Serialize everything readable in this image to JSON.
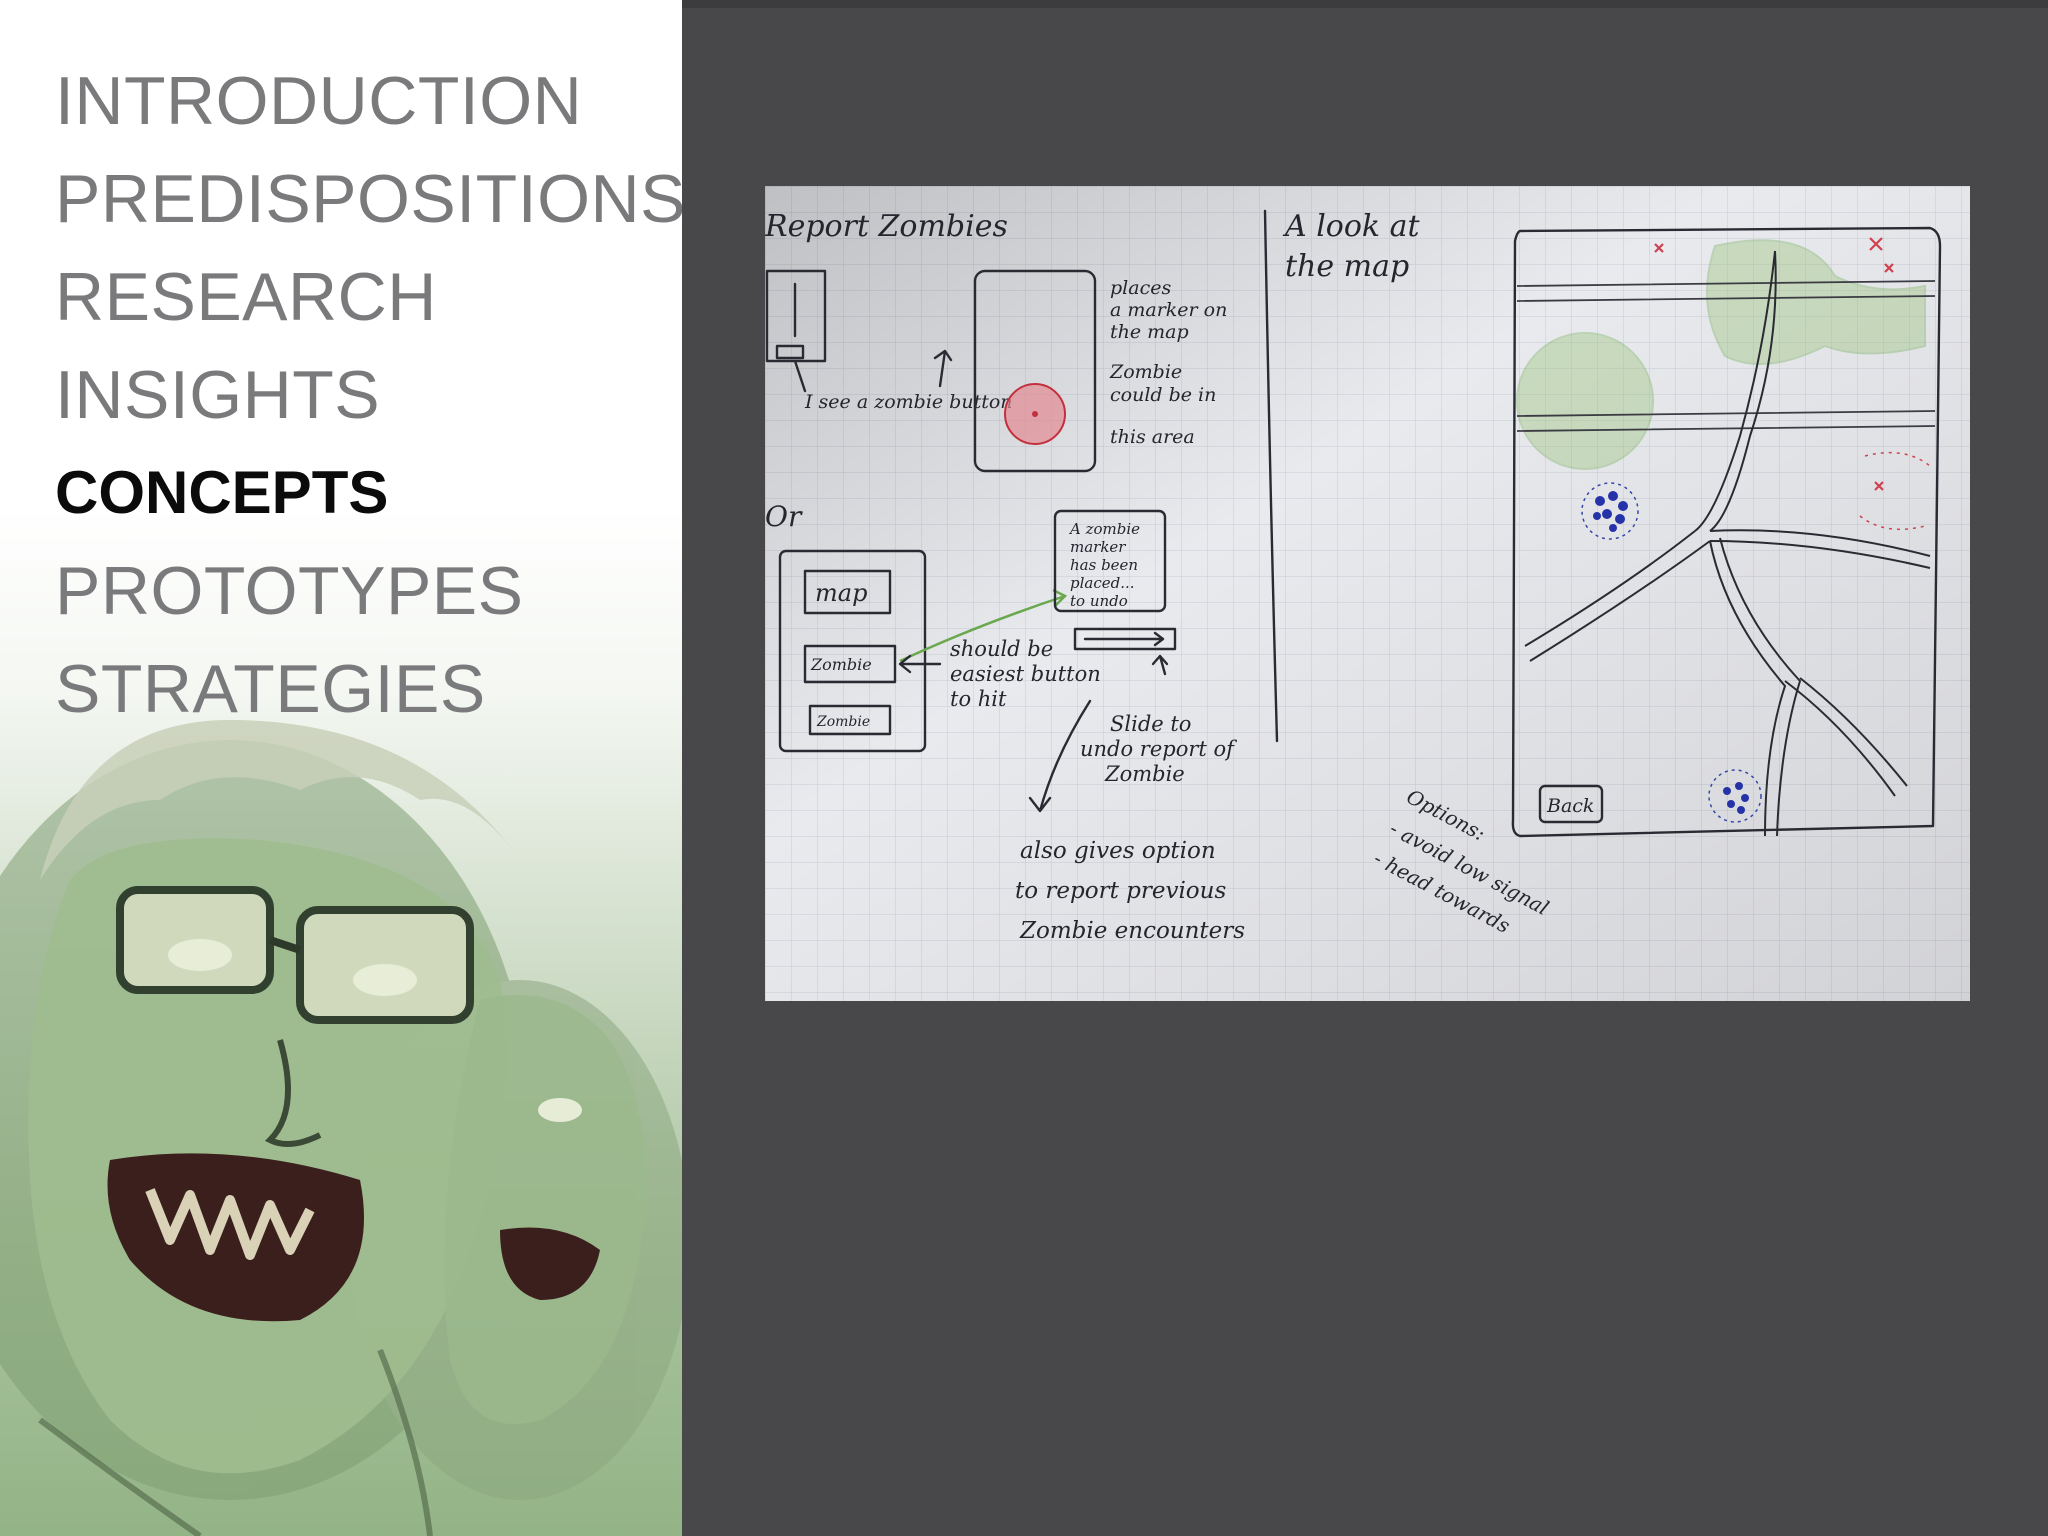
{
  "nav": {
    "items": [
      {
        "label": "INTRODUCTION"
      },
      {
        "label": "PREDISPOSITIONS"
      },
      {
        "label": "RESEARCH"
      },
      {
        "label": "INSIGHTS"
      },
      {
        "label": "CONCEPTS"
      },
      {
        "label": "PROTOTYPES"
      },
      {
        "label": "STRATEGIES"
      }
    ],
    "active_index": 4
  },
  "sketch": {
    "left_title": "Report Zombies",
    "button_note": "I see a zombie button",
    "places_note": [
      "places",
      "a marker on",
      "the map",
      "Zombie",
      "could be in",
      "this area"
    ],
    "or": "Or",
    "menu_map": "map",
    "menu_zombie": "Zombie",
    "menu_third": "Zombie",
    "confirm_note": [
      "A zombie",
      "marker",
      "has been",
      "placed...",
      "to undo"
    ],
    "easiest_note": [
      "should be",
      "easiest button",
      "to hit"
    ],
    "slide_note": [
      "Slide to",
      "undo report of",
      "Zombie"
    ],
    "also_note": [
      "also gives option",
      "to report previous",
      "Zombie encounters"
    ],
    "right_title": [
      "A look at",
      "the map"
    ],
    "back_button": "Back",
    "options_note": [
      "Options:",
      "- avoid low signal",
      "- head towards"
    ]
  },
  "colors": {
    "page_background": "#48474a",
    "nav_text": "#7a7a7c",
    "nav_active": "#0b0b0b",
    "paper": "#e9eaee",
    "ink": "#2a2a33"
  }
}
